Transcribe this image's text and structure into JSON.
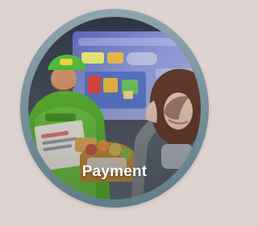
{
  "card": {
    "label": "Payment"
  },
  "photo": {
    "subject": "staff-and-customer-at-display-screen"
  },
  "colors": {
    "page_background": "#ddd2cf",
    "ring": "#6f8b96",
    "label_text": "#ffffff"
  }
}
